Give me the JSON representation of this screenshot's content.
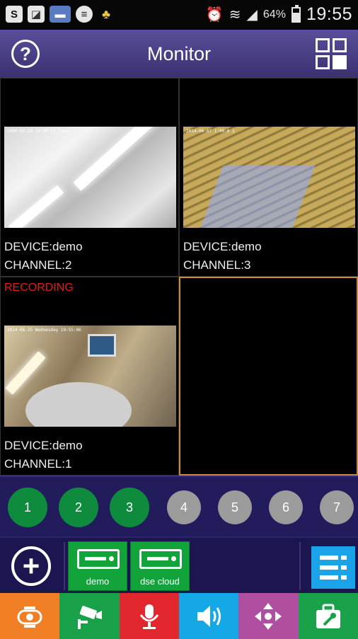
{
  "status_bar": {
    "left_icons": [
      "s-icon",
      "gallery-icon",
      "mail-icon",
      "chat-icon",
      "cleaner-icon"
    ],
    "battery_percent": "64%",
    "battery_level": 0.64,
    "time": "19:55"
  },
  "header": {
    "title": "Monitor",
    "help_glyph": "?"
  },
  "cells": [
    {
      "device": "DEVICE:demo",
      "channel": "CHANNEL:2",
      "osd": "2000-03-28 16:00:27 Tues"
    },
    {
      "device": "DEVICE:demo",
      "channel": "CHANNEL:3",
      "osd": "2014-06-07 1:00:0 1"
    },
    {
      "status": "RECORDING",
      "device": "DEVICE:demo",
      "channel": "CHANNEL:1",
      "osd": "2014-06-25 Wednesday 19:55:06"
    },
    {}
  ],
  "channels": [
    {
      "label": "1",
      "active": true
    },
    {
      "label": "2",
      "active": true
    },
    {
      "label": "3",
      "active": true
    },
    {
      "label": "4",
      "active": false
    },
    {
      "label": "5",
      "active": false
    },
    {
      "label": "6",
      "active": false
    },
    {
      "label": "7",
      "active": false
    }
  ],
  "devices": [
    {
      "name": "demo"
    },
    {
      "name": "dse cloud"
    }
  ],
  "toolbar": {
    "buttons": [
      "ptz-camera-icon",
      "cctv-camera-icon",
      "microphone-icon",
      "speaker-icon",
      "direction-arrows-icon",
      "toolbox-icon"
    ]
  },
  "colors": {
    "header": "#4a3f8a",
    "channel_active": "#0f8b3d",
    "channel_inactive": "#9b9b9b",
    "recording": "#e31b1b",
    "selected_cell_border": "#c98a3e",
    "device_tile": "#13a33b",
    "list_button": "#1aa3e8"
  }
}
